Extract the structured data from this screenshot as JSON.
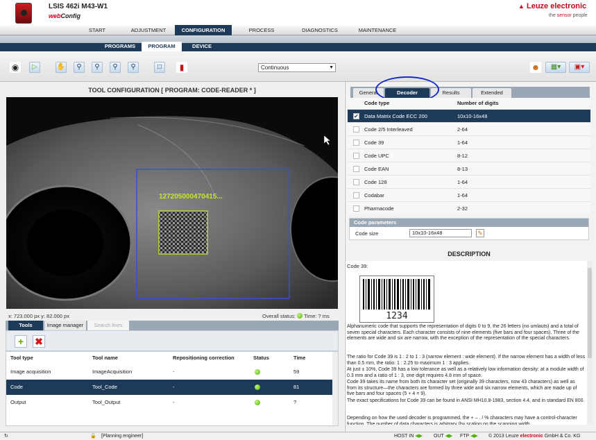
{
  "app": {
    "device": "LSIS 462i M43-W1",
    "web": "web",
    "config": "Config",
    "brand": "Leuze electronic",
    "tagline_pre": "the",
    "tagline_mid": "sensor",
    "tagline_post": "people"
  },
  "top_nav": [
    "START",
    "ADJUSTMENT",
    "CONFIGURATION",
    "PROCESS",
    "DIAGNOSTICS",
    "MAINTENANCE"
  ],
  "top_nav_active": "CONFIGURATION",
  "sub_nav": [
    "PROGRAMS",
    "PROGRAM",
    "DEVICE"
  ],
  "sub_nav_active": "PROGRAM",
  "toolbar": {
    "mode_select": "Continuous",
    "icons": [
      "camera-icon",
      "play-icon",
      "hand-icon",
      "zoom-in-icon",
      "zoom-out-icon",
      "zoom-fit-icon",
      "zoom-reset-icon",
      "roi-icon",
      "save-to-device-icon",
      "user-icon",
      "export-icon",
      "settings-icon"
    ]
  },
  "tool_config": {
    "title": "TOOL CONFIGURATION   [ PROGRAM: CODE-READER * ]",
    "code_overlay": "127205000470415...",
    "coords": "x: 723.000 px y: 82.000 px",
    "overall_status": "Overall status:",
    "time_label": "Time: ? ms"
  },
  "left_tabs": [
    "Tools",
    "Image manager",
    "Search lines"
  ],
  "tools_table": {
    "headers": [
      "Tool type",
      "Tool name",
      "Repositioning correction",
      "Status",
      "Time"
    ],
    "rows": [
      {
        "type": "Image acquisition",
        "name": "ImageAcquisition",
        "repo": "-",
        "time": "59"
      },
      {
        "type": "Code",
        "name": "Tool_Code",
        "repo": "-",
        "time": "81"
      },
      {
        "type": "Output",
        "name": "Tool_Output",
        "repo": "-",
        "time": "?"
      }
    ]
  },
  "right_tabs": [
    "General",
    "Decoder",
    "Results",
    "Extended"
  ],
  "right_tab_active": "Decoder",
  "decoder_table": {
    "headers": [
      "Code type",
      "Number of digits"
    ],
    "rows": [
      {
        "code": "Data Matrix Code ECC 200",
        "digits": "10x10-16x48",
        "checked": true
      },
      {
        "code": "Code 2/5 Interleaved",
        "digits": "2-64",
        "checked": false
      },
      {
        "code": "Code 39",
        "digits": "1-64",
        "checked": false
      },
      {
        "code": "Code UPC",
        "digits": "8-12",
        "checked": false
      },
      {
        "code": "Code EAN",
        "digits": "8-13",
        "checked": false
      },
      {
        "code": "Code 128",
        "digits": "1-64",
        "checked": false
      },
      {
        "code": "Codabar",
        "digits": "1-64",
        "checked": false
      },
      {
        "code": "Pharmacode",
        "digits": "2-32",
        "checked": false
      }
    ]
  },
  "code_params": {
    "title": "Code parameters",
    "label": "Code size",
    "value": "10x10-16x48"
  },
  "description": {
    "title": "DESCRIPTION",
    "heading": "Code 39:",
    "barcode_text": "1234",
    "p1": "Alphanumeric code that supports the representation of digits 0 to 9, the 26 letters (no umlauts) and a total of seven special characters. Each character consists of nine elements (five bars and four spaces). Three of the elements are wide and six are narrow, with the exception of the representation of the special characters.",
    "p2": "The ratio for Code 39 is 1 : 2 to 1 : 3 (narrow element : wide element). If the narrow element has a width of less than 0.5 mm, the ratio: 1 : 2.25 to maximum 1 : 3 applies.",
    "p3": "At just ± 10%, Code 39 has a low tolerance as well as a relatively low information density: at a module width of 0.3 mm and a ratio of 1 : 3, one digit requires 4.8 mm of space.",
    "p4": "Code 39 takes its name from both its character set (originally 39 characters, now 43 characters) as well as from its structure—the characters are formed by three wide and six narrow elements, which are made up of five bars and four spaces (5 + 4 = 9).",
    "p5": "The exact specifications for Code 39 can be found in ANSI MH10.8-1983, section 4.4, and in standard EN 800.",
    "p6": "Depending on how the used decoder is programmed, the + – . / % characters may have a control-character function. The number of data characters is arbitrary (by scaling on the scanning width,"
  },
  "status_bar": {
    "user": "[Planning engineer]",
    "host": "HOST IN",
    "out": "OUT",
    "ftp": "FTP",
    "copyright_pre": "© 2013 Leuze",
    "copyright_brand": "electronic",
    "copyright_post": "GmbH & Co. KG"
  },
  "colors": {
    "nav_dark": "#1d3a58",
    "brand_red": "#d0021b",
    "status_green": "#52b00f",
    "highlight_ring": "#1428c8"
  }
}
